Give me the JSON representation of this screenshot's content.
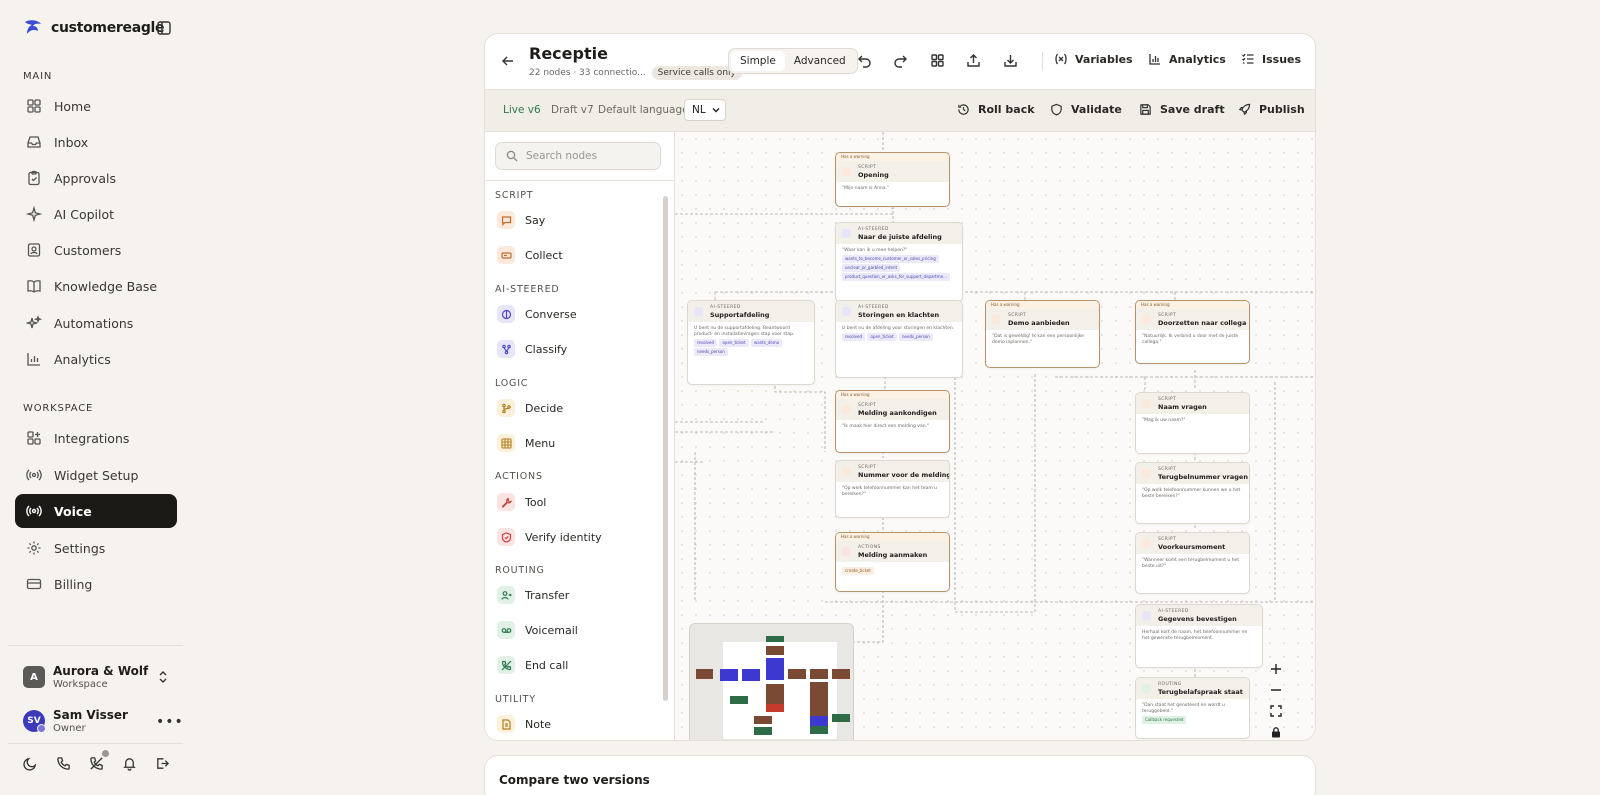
{
  "brand": {
    "name": "customereagle"
  },
  "sidebar": {
    "main_label": "MAIN",
    "main_items": [
      {
        "label": "Home",
        "icon": "home-icon"
      },
      {
        "label": "Inbox",
        "icon": "inbox-icon"
      },
      {
        "label": "Approvals",
        "icon": "clipboard-icon"
      },
      {
        "label": "AI Copilot",
        "icon": "sparkle-icon"
      },
      {
        "label": "Customers",
        "icon": "contact-icon"
      },
      {
        "label": "Knowledge Base",
        "icon": "book-icon"
      },
      {
        "label": "Automations",
        "icon": "stars-icon"
      },
      {
        "label": "Analytics",
        "icon": "bar-chart-icon"
      }
    ],
    "workspace_label": "WORKSPACE",
    "workspace_items": [
      {
        "label": "Integrations",
        "icon": "grid-plus-icon"
      },
      {
        "label": "Widget Setup",
        "icon": "broadcast-icon"
      },
      {
        "label": "Voice",
        "icon": "voice-waves-icon",
        "active": true
      },
      {
        "label": "Settings",
        "icon": "gear-icon"
      },
      {
        "label": "Billing",
        "icon": "card-icon"
      }
    ],
    "workspace": {
      "initial": "A",
      "name": "Aurora & Wolf",
      "subtitle": "Workspace"
    },
    "user": {
      "initials": "SV",
      "name": "Sam Visser",
      "role": "Owner"
    }
  },
  "editor": {
    "title": "Receptie",
    "meta": "22 nodes · 33 connectio...",
    "badge": "Service calls only",
    "mode_options": [
      "Simple",
      "Advanced"
    ],
    "mode_selected": "Simple",
    "toolbar": {
      "variables": "Variables",
      "analytics": "Analytics",
      "issues": "Issues"
    },
    "subbar": {
      "live": "Live v6",
      "draft": "Draft v7",
      "language_label": "Default language",
      "language_value": "NL",
      "rollback": "Roll back",
      "validate": "Validate",
      "save_draft": "Save draft",
      "publish": "Publish"
    },
    "palette": {
      "search_placeholder": "Search nodes",
      "groups": [
        {
          "label": "SCRIPT",
          "items": [
            "Say",
            "Collect"
          ]
        },
        {
          "label": "AI-STEERED",
          "items": [
            "Converse",
            "Classify"
          ]
        },
        {
          "label": "LOGIC",
          "items": [
            "Decide",
            "Menu"
          ]
        },
        {
          "label": "ACTIONS",
          "items": [
            "Tool",
            "Verify identity"
          ]
        },
        {
          "label": "ROUTING",
          "items": [
            "Transfer",
            "Voicemail",
            "End call"
          ]
        },
        {
          "label": "UTILITY",
          "items": [
            "Note"
          ]
        }
      ]
    },
    "nodes": [
      {
        "id": "opening",
        "type": "SCRIPT",
        "name": "Opening",
        "warning": "Has a warning",
        "body": "\"Mijn naam is Anna.\""
      },
      {
        "id": "juiste-afdeling",
        "type": "AI-STEERED",
        "name": "Naar de juiste afdeling",
        "body": "\"Waar kan ik u mee helpen?\"",
        "chips": [
          "wants_to_become_customer_or_sales_pricing",
          "unclear_or_garbled_intent",
          "product_question_or_asks_for_support_departme..."
        ]
      },
      {
        "id": "supportafdeling",
        "type": "AI-STEERED",
        "name": "Supportafdeling",
        "body": "U bent nu de supportafdeling. Beantwoord product- en installatievragen stap voor stap.",
        "chips": [
          "resolved",
          "open_ticket",
          "wants_demo",
          "needs_person"
        ]
      },
      {
        "id": "storingen",
        "type": "AI-STEERED",
        "name": "Storingen en klachten",
        "body": "U bent nu de afdeling voor storingen en klachten.",
        "chips": [
          "resolved",
          "open_ticket",
          "needs_person"
        ]
      },
      {
        "id": "demo",
        "type": "SCRIPT",
        "name": "Demo aanbieden",
        "warning": "Has a warning",
        "body": "\"Dat is geweldig! Ik kan een persoonlijke demo inplannen.\""
      },
      {
        "id": "doorzetten",
        "type": "SCRIPT",
        "name": "Doorzetten naar collega",
        "warning": "Has a warning",
        "body": "\"Natuurlijk. Ik verbind u door met de juiste collega.\""
      },
      {
        "id": "melding-aankondigen",
        "type": "SCRIPT",
        "name": "Melding aankondigen",
        "warning": "Has a warning",
        "body": "\"Ik maak hier direct een melding van.\""
      },
      {
        "id": "nummer-melding",
        "type": "SCRIPT",
        "name": "Nummer voor de melding",
        "body": "\"Op welk telefoonnummer kan het team u bereiken?\""
      },
      {
        "id": "melding-aanmaken",
        "type": "ACTIONS",
        "name": "Melding aanmaken",
        "warning": "Has a warning",
        "chips": [
          "create_ticket"
        ]
      },
      {
        "id": "naam-vragen",
        "type": "SCRIPT",
        "name": "Naam vragen",
        "body": "\"Mag ik uw naam?\""
      },
      {
        "id": "terugbelnummer",
        "type": "SCRIPT",
        "name": "Terugbelnummer vragen",
        "body": "\"Op welk telefoonnummer kunnen we u het beste bereiken?\""
      },
      {
        "id": "voorkeursmoment",
        "type": "SCRIPT",
        "name": "Voorkeursmoment",
        "body": "\"Wanneer komt een terugbelmoment u het beste uit?\""
      },
      {
        "id": "gegevens",
        "type": "AI-STEERED",
        "name": "Gegevens bevestigen",
        "body": "Herhaal kort de naam, het telefoonnummer en het gewenste terugbelmoment."
      },
      {
        "id": "terugbelafspraak",
        "type": "ROUTING",
        "name": "Terugbelafspraak staat",
        "body": "\"Dan staat het genoteerd en wordt u teruggebeld.\"",
        "chips": [
          "Callback requested"
        ]
      }
    ],
    "compare_title": "Compare two versions"
  },
  "colors": {
    "accent": "#1c1a17",
    "live": "#2f7a4f",
    "warning_border": "#b8936a"
  }
}
